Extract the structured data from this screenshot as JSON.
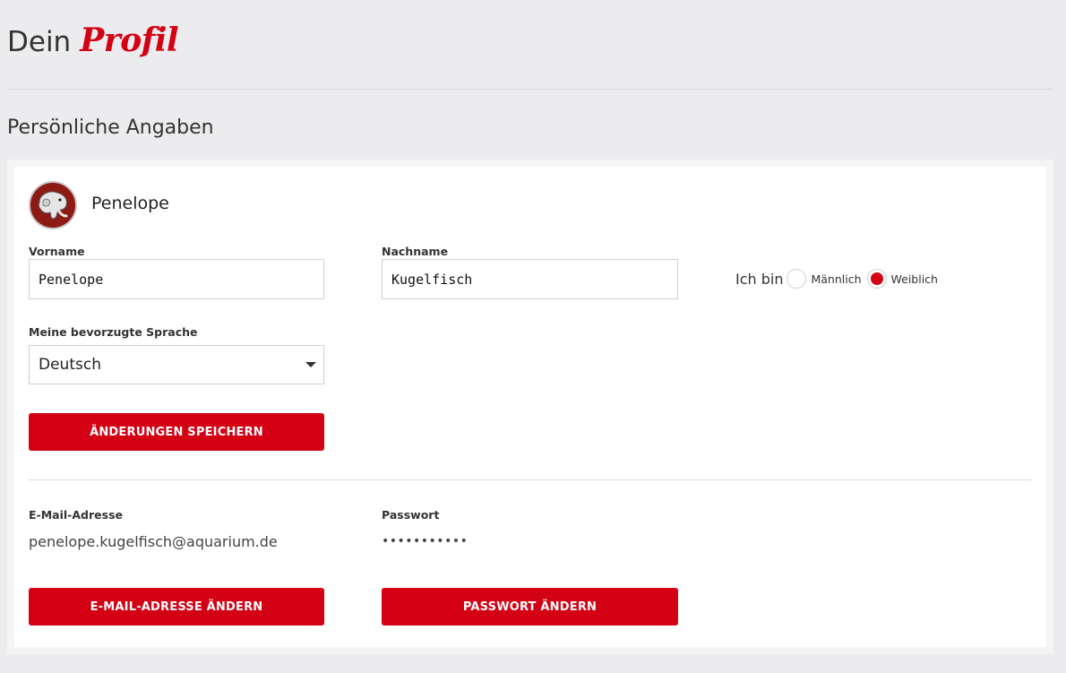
{
  "header": {
    "title_plain": "Dein",
    "title_accent": "Profil"
  },
  "section": {
    "heading": "Persönliche Angaben"
  },
  "profile": {
    "display_name": "Penelope",
    "avatar_icon": "elephant-avatar-icon"
  },
  "form": {
    "first_name_label": "Vorname",
    "first_name_value": "Penelope",
    "last_name_label": "Nachname",
    "last_name_value": "Kugelfisch",
    "gender_label": "Ich bin",
    "gender_options": [
      "Männlich",
      "Weiblich"
    ],
    "gender_selected": "Weiblich",
    "language_label": "Meine bevorzugte Sprache",
    "language_value": "Deutsch",
    "save_button": "ÄNDERUNGEN SPEICHERN"
  },
  "account": {
    "email_label": "E-Mail-Adresse",
    "email_value": "penelope.kugelfisch@aquarium.de",
    "password_label": "Passwort",
    "password_value": "•••••••••••",
    "change_email_button": "E-MAIL-ADRESSE ÄNDERN",
    "change_password_button": "PASSWORT ÄNDERN"
  },
  "colors": {
    "accent": "#d40014",
    "background": "#ececee",
    "card": "#ffffff"
  }
}
